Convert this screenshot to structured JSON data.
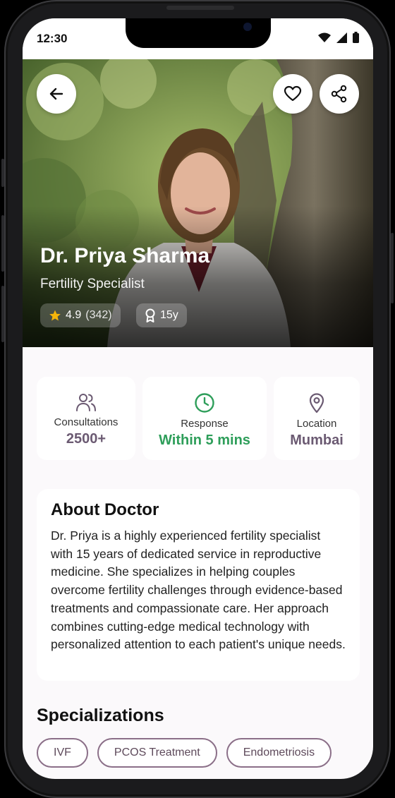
{
  "status": {
    "time": "12:30"
  },
  "doctor": {
    "name": "Dr. Priya Sharma",
    "specialty": "Fertility Specialist",
    "rating": "4.9",
    "reviews": "(342)",
    "experience": "15y"
  },
  "stats": [
    {
      "label": "Consultations",
      "value": "2500+",
      "icon": "users-icon",
      "color": "#6b5a72"
    },
    {
      "label": "Response",
      "value": "Within 5 mins",
      "icon": "clock-icon",
      "color": "#2e9e5a"
    },
    {
      "label": "Location",
      "value": "Mumbai",
      "icon": "location-pin-icon",
      "color": "#6b5a72"
    }
  ],
  "about": {
    "title": "About Doctor",
    "text": "Dr. Priya is a highly experienced fertility specialist with 15 years of dedicated service in reproductive medicine. She specializes in helping couples overcome fertility challenges through evidence-based treatments and compassionate care. Her approach combines cutting-edge medical technology with personalized attention to each patient's unique needs."
  },
  "specializations": {
    "title": "Specializations",
    "items": [
      "IVF",
      "PCOS Treatment",
      "Endometriosis"
    ]
  },
  "colors": {
    "accent": "#8b6f88",
    "success": "#2e9e5a",
    "star": "#f5b50a"
  }
}
